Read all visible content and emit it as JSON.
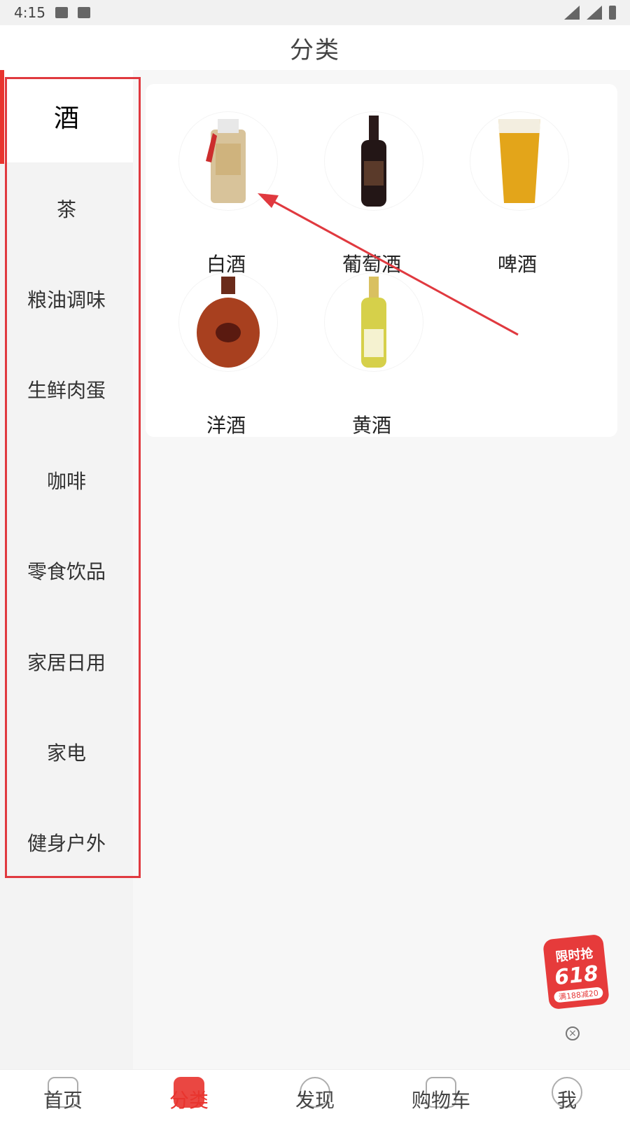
{
  "status_bar": {
    "time": "4:15"
  },
  "header": {
    "title": "分类"
  },
  "sidebar": {
    "items": [
      {
        "label": "酒",
        "active": true
      },
      {
        "label": "茶"
      },
      {
        "label": "粮油调味"
      },
      {
        "label": "生鲜肉蛋"
      },
      {
        "label": "咖啡"
      },
      {
        "label": "零食饮品"
      },
      {
        "label": "家居日用"
      },
      {
        "label": "家电"
      },
      {
        "label": "健身户外"
      }
    ]
  },
  "categories": [
    {
      "label": "白酒",
      "icon": "baijiu-bottle-icon"
    },
    {
      "label": "葡萄酒",
      "icon": "wine-bottle-icon"
    },
    {
      "label": "啤酒",
      "icon": "beer-glass-icon"
    },
    {
      "label": "洋酒",
      "icon": "xo-cognac-icon"
    },
    {
      "label": "黄酒",
      "icon": "yellow-wine-bottle-icon"
    }
  ],
  "promo": {
    "line1": "限时抢",
    "line2": "618",
    "line3": "满188减20"
  },
  "bottom_nav": {
    "items": [
      {
        "label": "首页"
      },
      {
        "label": "分类",
        "active": true
      },
      {
        "label": "发现"
      },
      {
        "label": "购物车"
      },
      {
        "label": "我"
      }
    ]
  },
  "colors": {
    "accent": "#e8342e",
    "annotation": "#e0393f"
  }
}
